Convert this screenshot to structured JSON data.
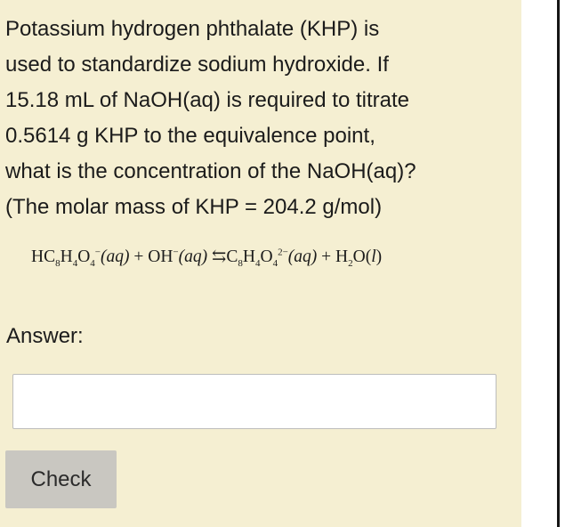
{
  "question": {
    "lines": [
      "Potassium hydrogen phthalate (KHP) is",
      "used to standardize sodium hydroxide. If",
      "15.18 mL of NaOH(aq) is required to titrate",
      "0.5614  g KHP to the equivalence point,",
      "what is the concentration of the NaOH(aq)?",
      "(The molar mass of KHP = 204.2 g/mol)"
    ]
  },
  "equation": {
    "r1_a": "HC",
    "r1_s1": "8",
    "r1_b": "H",
    "r1_s2": "4",
    "r1_c": "O",
    "r1_s3": "4",
    "r1_charge": "−",
    "r1_state": "(aq)",
    "plus1": " + ",
    "r2": "OH",
    "r2_charge": "−",
    "r2_state": "(aq)",
    "arrow": " ⇆",
    "p1_a": "C",
    "p1_s1": "8",
    "p1_b": "H",
    "p1_s2": "4",
    "p1_c": "O",
    "p1_s3": "4",
    "p1_charge": "2−",
    "p1_state": "(aq)",
    "plus2": " + ",
    "p2_a": "H",
    "p2_s1": "2",
    "p2_b": "O(",
    "p2_state": "l",
    "p2_close": ")"
  },
  "answer": {
    "label": "Answer:",
    "value": "",
    "placeholder": ""
  },
  "check_button": {
    "label": "Check"
  },
  "colors": {
    "panel_background": "#f5efd2",
    "button_background": "#c9c7c1",
    "text": "#1b1b1b"
  }
}
